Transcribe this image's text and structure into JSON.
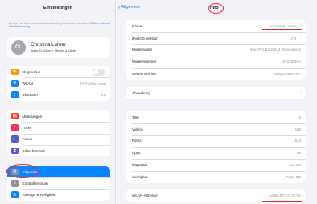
{
  "sidebar": {
    "title": "Einstellungen",
    "note": "Dieses iPad wird von Landratsamt Bamberg betreut und verwaltet.",
    "note_link": "Weitere Infos zur Gerätebetreuung ...",
    "profile": {
      "initials": "CL",
      "name": "Christina Lohrer",
      "subtitle": "Apple-ID, iCloud+, Medien & Käufe"
    },
    "group1": [
      {
        "label": "Flugmodus",
        "icon": "airplane-icon",
        "color": "#ff9500",
        "glyph": "✈",
        "control": "toggle",
        "toggle_on": false
      },
      {
        "label": "WLAN",
        "icon": "wifi-icon",
        "color": "#0a84ff",
        "glyph": "≋",
        "value": "FRITZ!Box Lohrer"
      },
      {
        "label": "Bluetooth",
        "icon": "bluetooth-icon",
        "color": "#0a84ff",
        "glyph": "ᛒ",
        "value": "Ein"
      }
    ],
    "group2": [
      {
        "label": "Mitteilungen",
        "icon": "notifications-icon",
        "color": "#ff3b30",
        "glyph": "▤"
      },
      {
        "label": "Töne",
        "icon": "sounds-icon",
        "color": "#ff2d55",
        "glyph": "♪"
      },
      {
        "label": "Fokus",
        "icon": "focus-moon-icon",
        "color": "#5856d6",
        "glyph": "☾"
      },
      {
        "label": "Bildschirmzeit",
        "icon": "screen-time-icon",
        "color": "#5856d6",
        "glyph": "⧗"
      }
    ],
    "group3": [
      {
        "label": "Allgemein",
        "icon": "gear-icon",
        "color": "#8e8e93",
        "glyph": "⚙",
        "selected": true
      },
      {
        "label": "Kontrollzentrum",
        "icon": "control-center-icon",
        "color": "#8e8e93",
        "glyph": "≡"
      },
      {
        "label": "Anzeige & Helligkeit",
        "icon": "display-brightness-icon",
        "color": "#0a84ff",
        "glyph": "A"
      }
    ]
  },
  "main": {
    "back_label": "Allgemein",
    "title": "Info",
    "group1": [
      {
        "label": "Name",
        "value": "Christina Lohrer",
        "chevron": true
      },
      {
        "label": "iPadOS-Version",
        "value": "17.0",
        "chevron": true
      },
      {
        "label": "Modellname",
        "value": "iPad Pro (11 Zoll, 2. Generation)"
      },
      {
        "label": "Modellnummer",
        "value": "MY232FD/A"
      },
      {
        "label": "Seriennummer",
        "value": "DMQDD83PTRF"
      }
    ],
    "group2": [
      {
        "label": "Abdeckung",
        "chevron": true
      }
    ],
    "group3": [
      {
        "label": "Titel",
        "value": "0"
      },
      {
        "label": "Videos",
        "value": "100"
      },
      {
        "label": "Fotos",
        "value": "543"
      },
      {
        "label": "Apps",
        "value": "86"
      },
      {
        "label": "Kapazität",
        "value": "128 GB"
      },
      {
        "label": "Verfügbar",
        "value": "74,21 GB"
      }
    ],
    "group4": [
      {
        "label": "WLAN-Adresse",
        "value": "64:8B:D7:CC:7E:9A"
      }
    ]
  },
  "annotation_color": "#e8281f",
  "accent_color": "#0a84ff"
}
